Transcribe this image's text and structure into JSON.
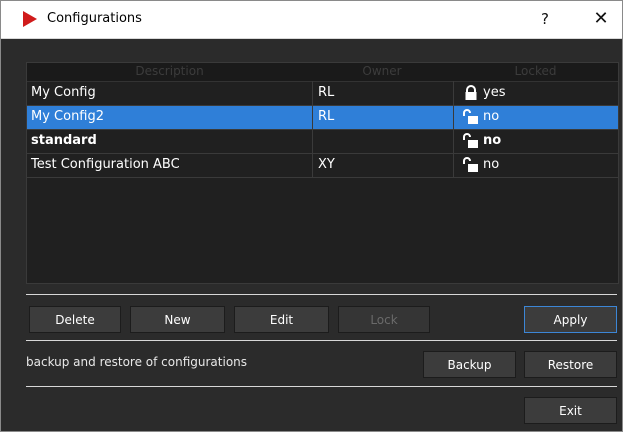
{
  "window": {
    "title": "Configurations",
    "help_label": "?",
    "close_label": "✕"
  },
  "table": {
    "headers": {
      "description": "Description",
      "owner": "Owner",
      "locked": "Locked"
    },
    "rows": [
      {
        "description": "My Config",
        "owner": "RL",
        "locked": "yes",
        "lock_state": "closed",
        "selected": false,
        "bold": false
      },
      {
        "description": "My Config2",
        "owner": "RL",
        "locked": "no",
        "lock_state": "open",
        "selected": true,
        "bold": false
      },
      {
        "description": "standard",
        "owner": "",
        "locked": "no",
        "lock_state": "open",
        "selected": false,
        "bold": true
      },
      {
        "description": "Test Configuration ABC",
        "owner": "XY",
        "locked": "no",
        "lock_state": "open",
        "selected": false,
        "bold": false
      }
    ]
  },
  "buttons": {
    "delete": "Delete",
    "new": "New",
    "edit": "Edit",
    "lock": "Lock",
    "apply": "Apply",
    "backup": "Backup",
    "restore": "Restore",
    "exit": "Exit"
  },
  "backup_caption": "backup and restore of configurations",
  "colors": {
    "accent": "#2f7fd8",
    "brand": "#d01b1b",
    "background": "#2b2b2b"
  },
  "icons": {
    "app": "app-logo-icon",
    "lock_closed": "lock-closed-icon",
    "lock_open": "lock-open-icon"
  }
}
